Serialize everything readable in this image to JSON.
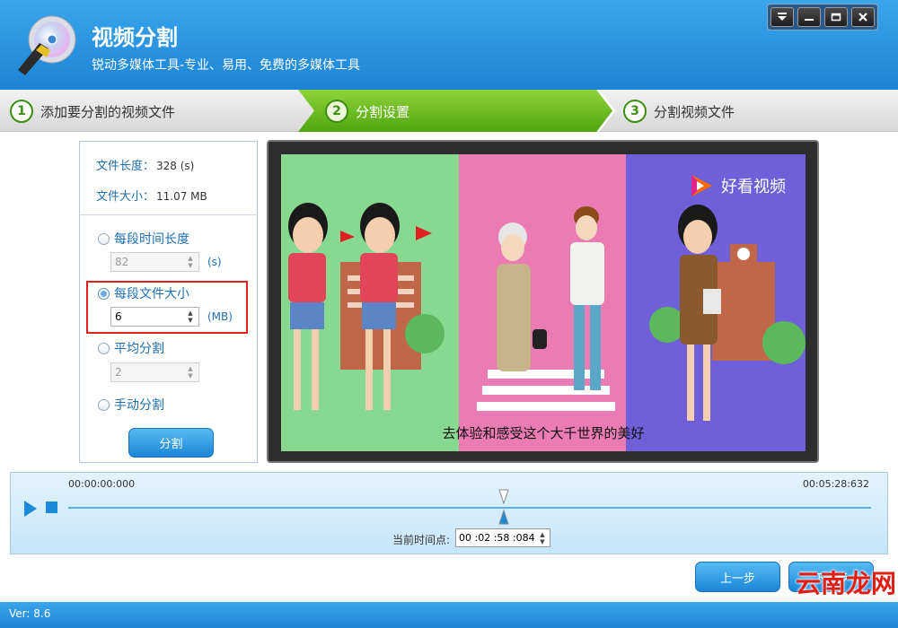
{
  "window": {
    "title": "视频分割",
    "subtitle": "锐动多媒体工具-专业、易用、免费的多媒体工具",
    "controls": [
      "menu-icon",
      "minimize-icon",
      "maximize-icon",
      "close-icon"
    ]
  },
  "steps": [
    {
      "number": "1",
      "label": "添加要分割的视频文件"
    },
    {
      "number": "2",
      "label": "分割设置"
    },
    {
      "number": "3",
      "label": "分割视频文件"
    }
  ],
  "file_info": {
    "length_label": "文件长度：",
    "length_value": "328 (s)",
    "size_label": "文件大小：",
    "size_value": "11.07 MB"
  },
  "options": {
    "time": {
      "label": "每段时间长度",
      "value": "82",
      "unit": "(s)"
    },
    "size": {
      "label": "每段文件大小",
      "value": "6",
      "unit": "(MB)"
    },
    "average": {
      "label": "平均分割",
      "value": "2"
    },
    "manual": {
      "label": "手动分割"
    },
    "selected": "size"
  },
  "split_button": "分割",
  "preview": {
    "watermark": "好看视频",
    "subtitle": "去体验和感受这个大千世界的美好"
  },
  "timeline": {
    "start": "00:00:00:000",
    "end": "00:05:28:632",
    "current_label": "当前时间点:",
    "current_value": "00 :02 :58 :084",
    "position_fraction": 0.543
  },
  "nav": {
    "prev": "上一步",
    "next": "下一步"
  },
  "status": {
    "version": "Ver: 8.6"
  },
  "site_watermark": "云南龙网",
  "colors": {
    "accent": "#1c84d6",
    "step_active": "#5cb11a",
    "highlight": "#e0201c"
  }
}
